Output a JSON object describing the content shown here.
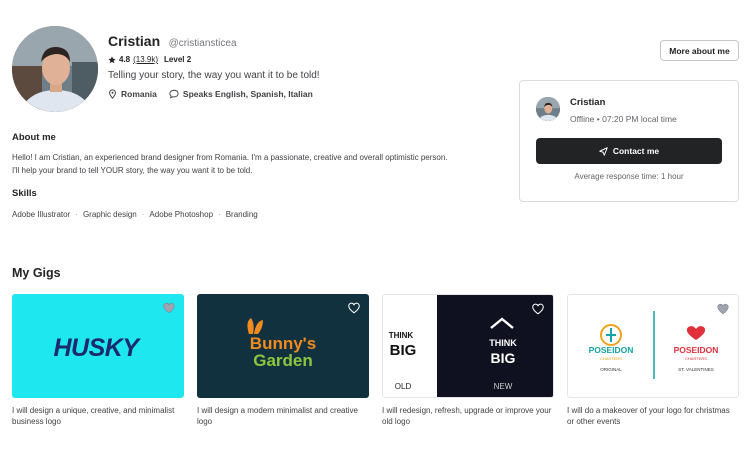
{
  "profile": {
    "name": "Cristian",
    "username": "@cristiansticea",
    "rating": "4.8",
    "review_count": "(13.9k)",
    "level": "Level 2",
    "tagline": "Telling your story, the way you want it to be told!",
    "country": "Romania",
    "languages": "Speaks English, Spanish, Italian"
  },
  "header": {
    "more_button": "More about me"
  },
  "contact_card": {
    "name": "Cristian",
    "status": "Offline • 07:20 PM local time",
    "button": "Contact me",
    "response_time": "Average response time: 1 hour"
  },
  "about": {
    "title": "About me",
    "text": "Hello! I am Cristian, an experienced brand designer from Romania. I'm a passionate, creative and overall optimistic person. I'll help your brand to tell YOUR story, the way you want it to be told."
  },
  "skills": {
    "title": "Skills",
    "items": [
      "Adobe Illustrator",
      "Graphic design",
      "Adobe Photoshop",
      "Branding"
    ]
  },
  "gigs": {
    "title": "My Gigs",
    "items": [
      {
        "caption": "I will design a unique, creative, and minimalist business logo",
        "logo": "HUSKY",
        "bg": "#1ee7f0"
      },
      {
        "caption": "I will design a modern minimalist and creative logo",
        "logo_line1": "Bunny's",
        "logo_line2": "Garden",
        "bg": "#12313f"
      },
      {
        "caption": "I will redesign, refresh, upgrade or improve your old logo",
        "think": "THINK",
        "big": "BIG",
        "old": "OLD",
        "new": "NEW"
      },
      {
        "caption": "I will do a makeover of your logo for christmas or other events",
        "brand": "POSEIDON",
        "sub": "CHARTERS",
        "original": "ORIGINAL",
        "valentine": "ST. VALENTINES"
      }
    ]
  },
  "colors": {
    "accent": "#222325",
    "husky_bg": "#1ee7f0",
    "bunny_bg": "#12313f",
    "poseidon_teal": "#13a3a3",
    "poseidon_red": "#e0303a"
  }
}
